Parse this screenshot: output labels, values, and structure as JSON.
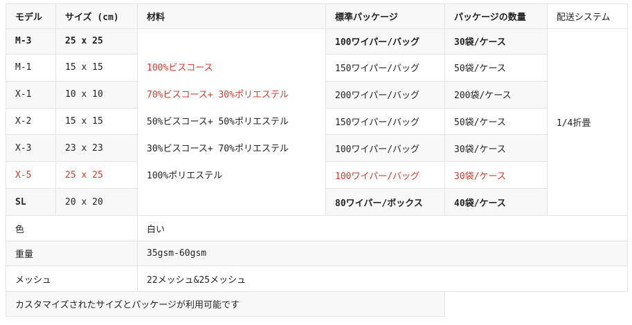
{
  "header": {
    "model": "モデル",
    "size": "サイズ (cm)",
    "material": "材料",
    "package": "標準パッケージ",
    "qty": "パッケージの数量",
    "delivery": "配送システム"
  },
  "rows": [
    {
      "model": "M-3",
      "size": "25 x 25",
      "package": "100ワイパー/バッグ",
      "qty": "30袋/ケース"
    },
    {
      "model": "M-1",
      "size": "15 x 15",
      "package": "150ワイパー/バッグ",
      "qty": "50袋/ケース"
    },
    {
      "model": "X-1",
      "size": "10 x 10",
      "package": "200ワイパー/バッグ",
      "qty": "200袋/ケース"
    },
    {
      "model": "X-2",
      "size": "15 x 15",
      "package": "150ワイパー/バッグ",
      "qty": "50袋/ケース"
    },
    {
      "model": "X-3",
      "size": "23 x 23",
      "package": "100ワイパー/バッグ",
      "qty": "30袋/ケース"
    },
    {
      "model": "X-5",
      "size": "25 x 25",
      "package": "100ワイパー/バッグ",
      "qty": "30袋/ケース"
    },
    {
      "model": "SL",
      "size": "20 x 20",
      "package": "80ワイパー/ボックス",
      "qty": "40袋/ケース"
    }
  ],
  "materials": [
    "100%ビスコース",
    "70%ビスコース+ 30%ポリエステル",
    "50%ビスコース+ 50%ポリエステル",
    "30%ビスコース+ 70%ポリエステル",
    "100%ポリエステル"
  ],
  "delivery_value": "1/4折畳",
  "attributes": [
    {
      "label": "色",
      "value": "白い"
    },
    {
      "label": "重量",
      "value": "35gsm-60gsm"
    },
    {
      "label": "メッシュ",
      "value": "22メッシュ&25メッシュ"
    }
  ],
  "note": "カスタマイズされたサイズとパッケージが利用可能です",
  "colors": {
    "highlight_red": "#d9382b",
    "stripe": "#f8f8f8",
    "border": "#e3e3e3"
  }
}
